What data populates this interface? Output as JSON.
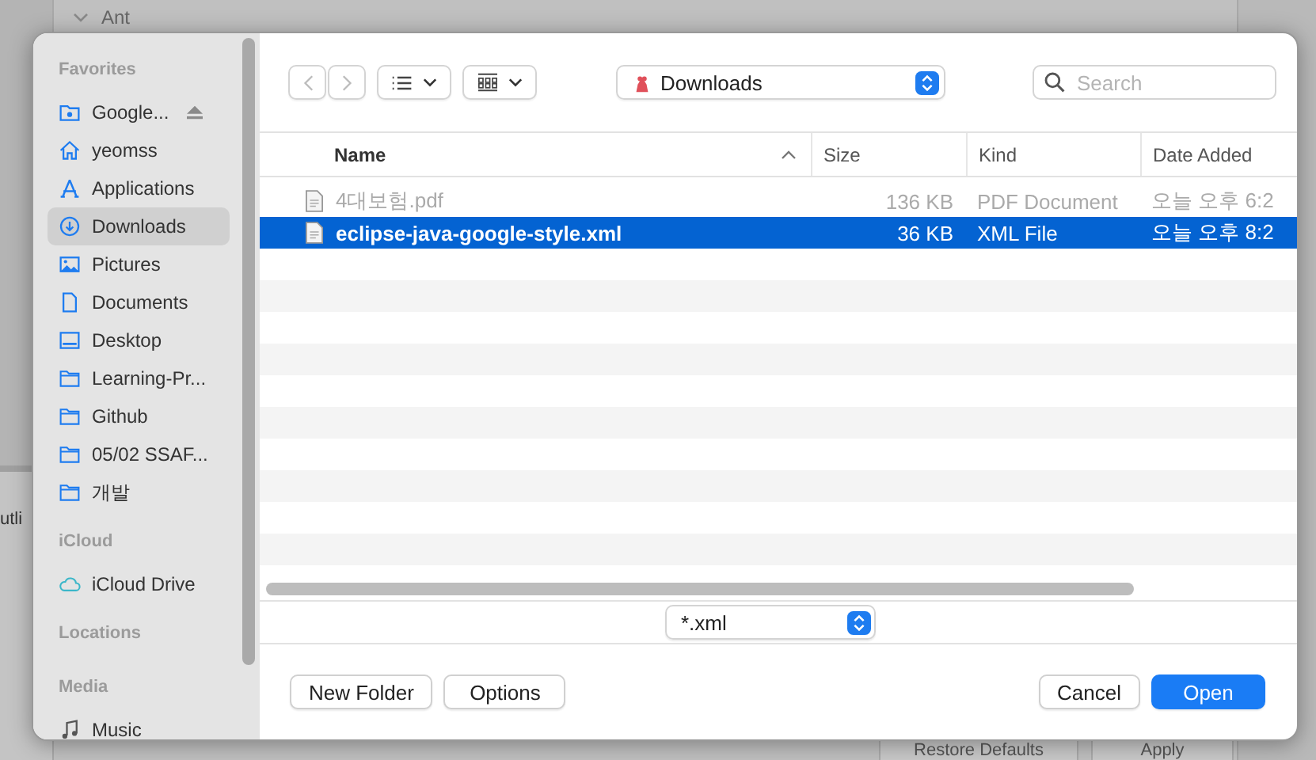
{
  "background": {
    "tree_item": "Ant",
    "panel_title": "utli",
    "buttons": [
      "Restore Defaults",
      "Apply"
    ]
  },
  "sidebar": {
    "sections": [
      {
        "title": "Favorites",
        "items": [
          {
            "label": "Google...",
            "kind": "drive",
            "ejectable": true,
            "selected": false
          },
          {
            "label": "yeomss",
            "kind": "home",
            "ejectable": false,
            "selected": false
          },
          {
            "label": "Applications",
            "kind": "apps",
            "ejectable": false,
            "selected": false
          },
          {
            "label": "Downloads",
            "kind": "download",
            "ejectable": false,
            "selected": true
          },
          {
            "label": "Pictures",
            "kind": "pictures",
            "ejectable": false,
            "selected": false
          },
          {
            "label": "Documents",
            "kind": "document",
            "ejectable": false,
            "selected": false
          },
          {
            "label": "Desktop",
            "kind": "desktop",
            "ejectable": false,
            "selected": false
          },
          {
            "label": "Learning-Pr...",
            "kind": "folder",
            "ejectable": false,
            "selected": false
          },
          {
            "label": "Github",
            "kind": "folder",
            "ejectable": false,
            "selected": false
          },
          {
            "label": "05/02 SSAF...",
            "kind": "folder",
            "ejectable": false,
            "selected": false
          },
          {
            "label": "개발",
            "kind": "folder",
            "ejectable": false,
            "selected": false
          }
        ]
      },
      {
        "title": "iCloud",
        "items": [
          {
            "label": "iCloud Drive",
            "kind": "cloud",
            "ejectable": false,
            "selected": false
          }
        ]
      },
      {
        "title": "Locations"
      },
      {
        "title": "Media",
        "items": [
          {
            "label": "Music",
            "kind": "music",
            "ejectable": false,
            "selected": false
          }
        ]
      }
    ]
  },
  "toolbar": {
    "location": "Downloads",
    "search": {
      "placeholder": "Search"
    }
  },
  "table": {
    "columns": [
      {
        "label": "Name",
        "sorted": true
      },
      {
        "label": "Size",
        "sorted": false
      },
      {
        "label": "Kind",
        "sorted": false
      },
      {
        "label": "Date Added",
        "sorted": false
      }
    ],
    "rows": [
      {
        "name": "4대보험.pdf",
        "size": "136 KB",
        "kind": "PDF Document",
        "date": "오늘 오후 6:2",
        "enabled": false,
        "selected": false
      },
      {
        "name": "eclipse-java-google-style.xml",
        "size": "36 KB",
        "kind": "XML File",
        "date": "오늘 오후 8:2",
        "enabled": true,
        "selected": true
      }
    ]
  },
  "filter": "*.xml",
  "buttons": {
    "left": [
      "New Folder",
      "Options"
    ],
    "cancel": "Cancel",
    "confirm": "Open"
  }
}
